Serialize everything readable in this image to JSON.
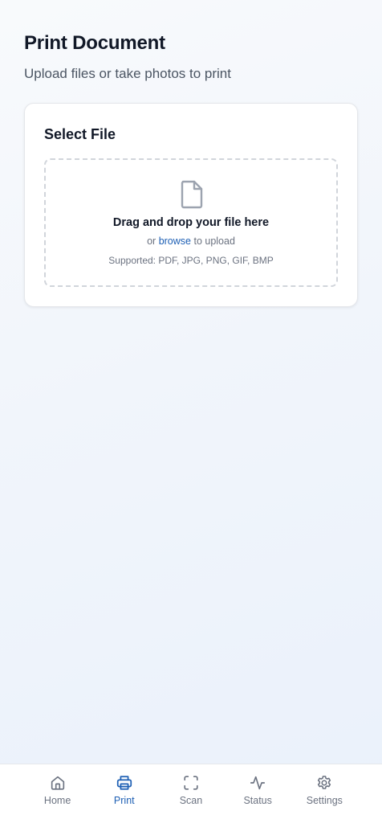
{
  "page": {
    "title": "Print Document",
    "subtitle": "Upload files or take photos to print"
  },
  "file_card": {
    "title": "Select File",
    "dropzone": {
      "icon": "file-icon",
      "headline": "Drag and drop your file here",
      "prefix": "or",
      "browse_label": "browse",
      "suffix": "to upload",
      "supported": "Supported: PDF, JPG, PNG, GIF, BMP"
    }
  },
  "bottom_nav": {
    "active": "Print",
    "active_color": "#1d5fb4",
    "items": [
      {
        "label": "Home",
        "icon": "home-icon"
      },
      {
        "label": "Print",
        "icon": "printer-icon"
      },
      {
        "label": "Scan",
        "icon": "scan-icon"
      },
      {
        "label": "Status",
        "icon": "activity-icon"
      },
      {
        "label": "Settings",
        "icon": "gear-icon"
      }
    ]
  }
}
